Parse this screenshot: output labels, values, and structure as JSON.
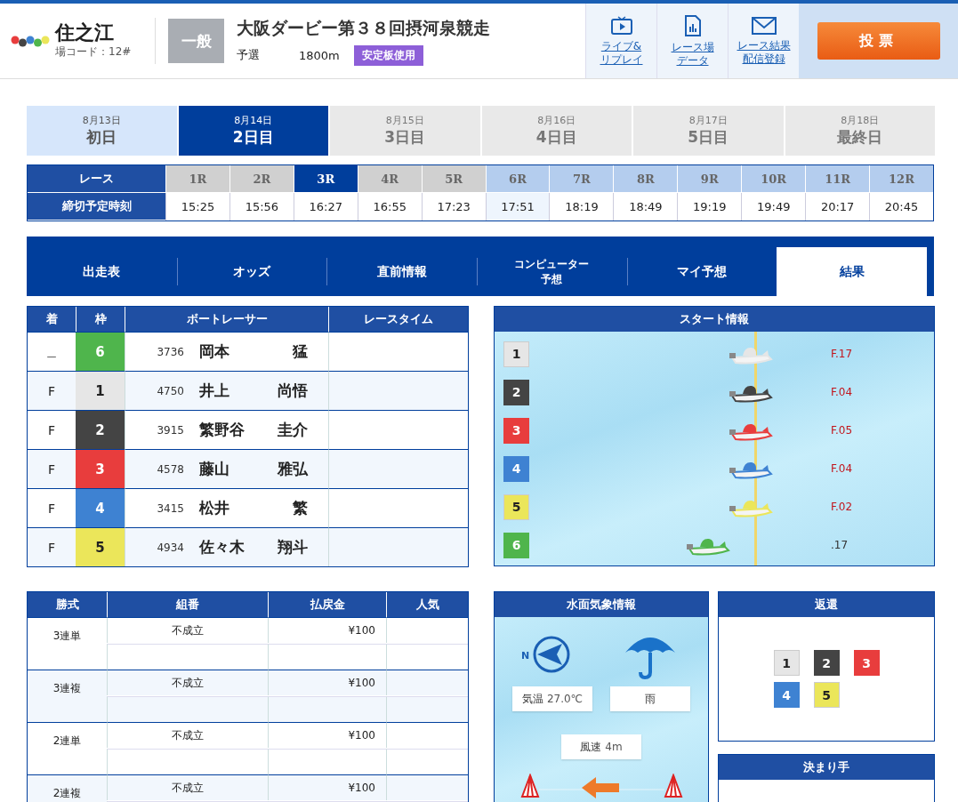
{
  "header": {
    "venue": "住之江",
    "venue_code": "場コード：12#",
    "grade": "一般",
    "race_title": "大阪ダービー第３８回摂河泉競走",
    "race_type": "予選",
    "distance": "1800m",
    "badge": "安定板使用",
    "links": [
      {
        "lines": [
          "ライブ&",
          "リプレイ"
        ]
      },
      {
        "lines": [
          "レース場",
          "データ"
        ]
      },
      {
        "lines": [
          "レース結果",
          "配信登録"
        ]
      }
    ],
    "vote_button": "投票"
  },
  "days": [
    {
      "date": "8月13日",
      "label": "初日",
      "selected": false,
      "past": true
    },
    {
      "date": "8月14日",
      "label": "2日目",
      "selected": true,
      "past": false
    },
    {
      "date": "8月15日",
      "label": "3日目",
      "selected": false,
      "past": false
    },
    {
      "date": "8月16日",
      "label": "4日目",
      "selected": false,
      "past": false
    },
    {
      "date": "8月17日",
      "label": "5日目",
      "selected": false,
      "past": false
    },
    {
      "date": "8月18日",
      "label": "最終日",
      "selected": false,
      "past": false
    }
  ],
  "races": {
    "row_labels": [
      "レース",
      "締切予定時刻"
    ],
    "items": [
      {
        "label": "1R",
        "time": "15:25",
        "selected": false,
        "finished": true,
        "next": false
      },
      {
        "label": "2R",
        "time": "15:56",
        "selected": false,
        "finished": true,
        "next": false
      },
      {
        "label": "3R",
        "time": "16:27",
        "selected": true,
        "finished": true,
        "next": false
      },
      {
        "label": "4R",
        "time": "16:55",
        "selected": false,
        "finished": true,
        "next": false
      },
      {
        "label": "5R",
        "time": "17:23",
        "selected": false,
        "finished": true,
        "next": false
      },
      {
        "label": "6R",
        "time": "17:51",
        "selected": false,
        "finished": false,
        "next": true
      },
      {
        "label": "7R",
        "time": "18:19",
        "selected": false,
        "finished": false,
        "next": false
      },
      {
        "label": "8R",
        "time": "18:49",
        "selected": false,
        "finished": false,
        "next": false
      },
      {
        "label": "9R",
        "time": "19:19",
        "selected": false,
        "finished": false,
        "next": false
      },
      {
        "label": "10R",
        "time": "19:49",
        "selected": false,
        "finished": false,
        "next": false
      },
      {
        "label": "11R",
        "time": "20:17",
        "selected": false,
        "finished": false,
        "next": false
      },
      {
        "label": "12R",
        "time": "20:45",
        "selected": false,
        "finished": false,
        "next": false
      }
    ]
  },
  "nav_tabs": [
    {
      "lines": [
        "出走表"
      ],
      "selected": false
    },
    {
      "lines": [
        "オッズ"
      ],
      "selected": false
    },
    {
      "lines": [
        "直前情報"
      ],
      "selected": false
    },
    {
      "lines": [
        "コンピューター",
        "予想"
      ],
      "selected": false
    },
    {
      "lines": [
        "マイ予想"
      ],
      "selected": false
    },
    {
      "lines": [
        "結果"
      ],
      "selected": true
    }
  ],
  "results": {
    "columns": [
      "着",
      "枠",
      "ボートレーサー",
      "レースタイム"
    ],
    "rows": [
      {
        "place": "＿",
        "lane": "6",
        "color": "#4fb54c",
        "racer_no": "3736",
        "family_name": "岡本",
        "given_name": "猛"
      },
      {
        "place": "F",
        "lane": "1",
        "color": "#e6e6e6",
        "racer_no": "4750",
        "family_name": "井上",
        "given_name": "尚悟"
      },
      {
        "place": "F",
        "lane": "2",
        "color": "#444444",
        "racer_no": "3915",
        "family_name": "繁野谷",
        "given_name": "圭介"
      },
      {
        "place": "F",
        "lane": "3",
        "color": "#e83d3d",
        "racer_no": "4578",
        "family_name": "藤山",
        "given_name": "雅弘"
      },
      {
        "place": "F",
        "lane": "4",
        "color": "#3e82d2",
        "racer_no": "3415",
        "family_name": "松井",
        "given_name": "繁"
      },
      {
        "place": "F",
        "lane": "5",
        "color": "#ebe65a",
        "racer_no": "4934",
        "family_name": "佐々木",
        "given_name": "翔斗"
      }
    ]
  },
  "start_info": {
    "title": "スタート情報",
    "boats": [
      {
        "lane": "1",
        "color": "#e6e6e6",
        "timing": "F.17",
        "flying": true
      },
      {
        "lane": "2",
        "color": "#444444",
        "timing": "F.04",
        "flying": true
      },
      {
        "lane": "3",
        "color": "#e83d3d",
        "timing": "F.05",
        "flying": true
      },
      {
        "lane": "4",
        "color": "#3e82d2",
        "timing": "F.04",
        "flying": true
      },
      {
        "lane": "5",
        "color": "#ebe65a",
        "timing": "F.02",
        "flying": true
      },
      {
        "lane": "6",
        "color": "#4fb54c",
        "timing": ".17",
        "flying": false
      }
    ]
  },
  "payouts": {
    "columns": [
      "勝式",
      "組番",
      "払戻金",
      "人気"
    ],
    "rows": [
      {
        "bet_type": "3連単",
        "combination": "不成立",
        "amount": "¥100"
      },
      {
        "bet_type": "3連複",
        "combination": "不成立",
        "amount": "¥100"
      },
      {
        "bet_type": "2連単",
        "combination": "不成立",
        "amount": "¥100"
      },
      {
        "bet_type": "2連複",
        "combination": "不成立",
        "amount": "¥100"
      }
    ]
  },
  "weather": {
    "title": "水面気象情報",
    "compass_label": "N",
    "temperature_label": "気温",
    "temperature": "27.0℃",
    "condition": "雨",
    "wind_label": "風速",
    "wind": "4m"
  },
  "refund": {
    "title": "返還",
    "lanes": [
      {
        "lane": "1",
        "color": "#e6e6e6"
      },
      {
        "lane": "2",
        "color": "#444444"
      },
      {
        "lane": "3",
        "color": "#e83d3d"
      },
      {
        "lane": "4",
        "color": "#3e82d2"
      },
      {
        "lane": "5",
        "color": "#ebe65a"
      }
    ]
  },
  "winning_move": {
    "title": "決まり手"
  }
}
